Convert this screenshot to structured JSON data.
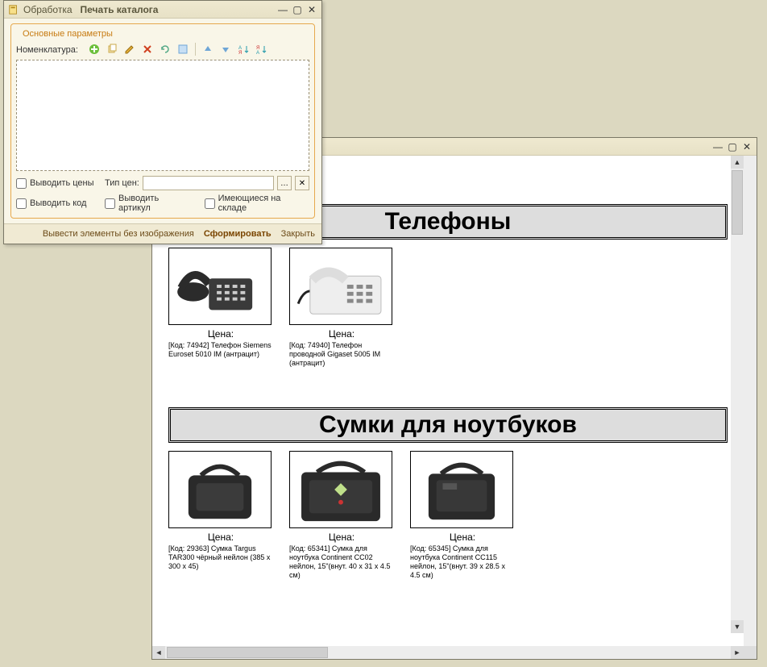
{
  "dialog": {
    "title_prefix": "Обработка",
    "title_main": "Печать каталога",
    "fieldset_title": "Основные параметры",
    "label_nomenclature": "Номенклатура:",
    "toolbar_icons": [
      "add",
      "copy",
      "edit",
      "delete",
      "refresh",
      "finish",
      "up",
      "down",
      "sort-asc",
      "sort-desc"
    ],
    "chk_output_prices": "Выводить цены",
    "price_type_label": "Тип цен:",
    "price_type_value": "",
    "chk_output_code": "Выводить код",
    "chk_output_article": "Выводить артикул",
    "chk_in_stock": "Имеющиеся на складе",
    "footer_output_no_image": "Вывести элементы без изображения",
    "footer_form": "Сформировать",
    "footer_close": "Закрыть"
  },
  "preview": {
    "categories": [
      {
        "title": "Телефоны",
        "products": [
          {
            "price_label": "Цена:",
            "desc": "[Код: 74942] Телефон Siemens Euroset 5010 IM (антрацит)",
            "image": "phone-dark"
          },
          {
            "price_label": "Цена:",
            "desc": "[Код: 74940] Телефон проводной Gigaset 5005 IM (антрацит)",
            "image": "phone-light"
          }
        ]
      },
      {
        "title": "Сумки для ноутбуков",
        "products": [
          {
            "price_label": "Цена:",
            "desc": "[Код: 29363] Сумка Targus TAR300 чёрный нейлон (385 x 300 x 45)",
            "image": "bag1"
          },
          {
            "price_label": "Цена:",
            "desc": "[Код: 65341] Сумка для ноутбука Continent CC02 нейлон, 15\"(внут. 40 x 31 x 4.5 см)",
            "image": "bag2"
          },
          {
            "price_label": "Цена:",
            "desc": "[Код: 65345] Сумка для ноутбука Continent CC115 нейлон, 15\"(внут. 39 x 28.5 x 4.5 см)",
            "image": "bag3"
          }
        ]
      }
    ]
  }
}
